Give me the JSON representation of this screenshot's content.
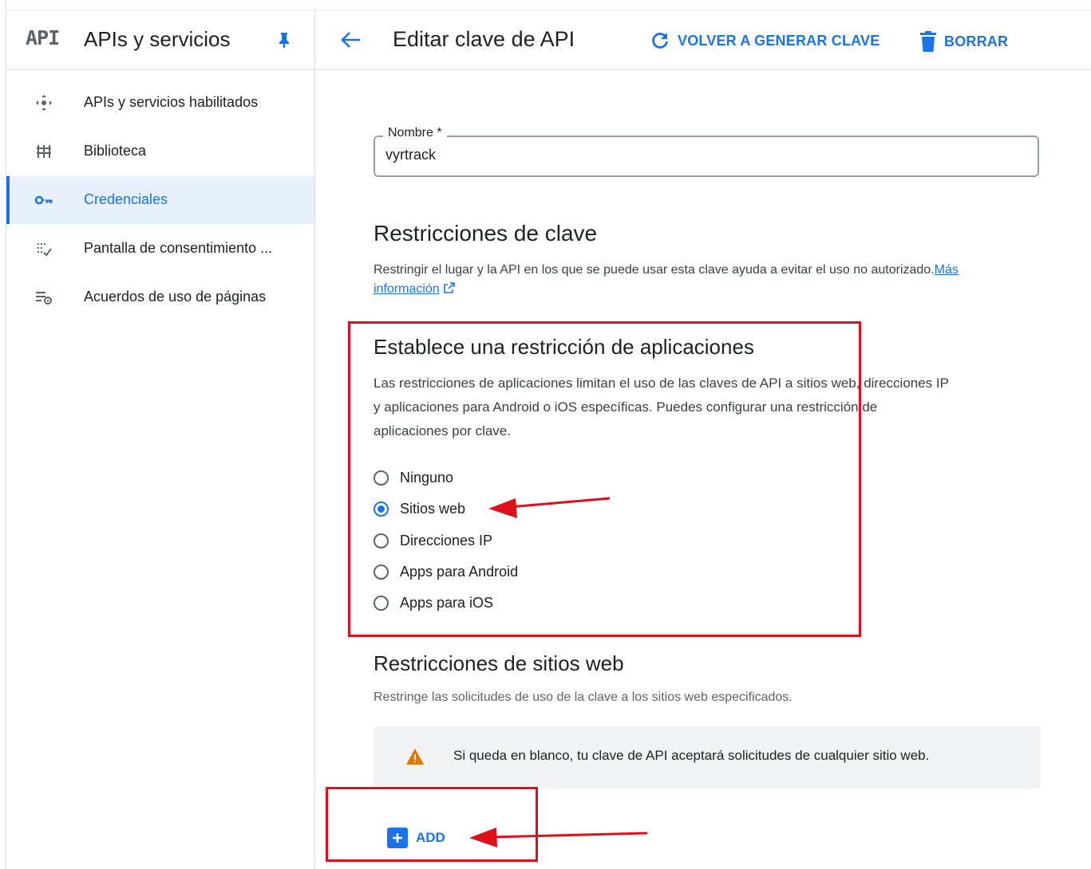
{
  "sidebar": {
    "logo_text": "API",
    "title": "APIs y servicios",
    "items": [
      {
        "label": "APIs y servicios habilitados",
        "icon": "apis-dashboard-icon",
        "active": false
      },
      {
        "label": "Biblioteca",
        "icon": "library-icon",
        "active": false
      },
      {
        "label": "Credenciales",
        "icon": "key-icon",
        "active": true
      },
      {
        "label": "Pantalla de consentimiento ...",
        "icon": "consent-screen-icon",
        "active": false
      },
      {
        "label": "Acuerdos de uso de páginas",
        "icon": "page-agreements-icon",
        "active": false
      }
    ]
  },
  "header": {
    "title": "Editar clave de API",
    "regenerate_label": "VOLVER A GENERAR CLAVE",
    "delete_label": "BORRAR"
  },
  "name_field": {
    "label": "Nombre *",
    "value": "vyrtrack"
  },
  "key_restrictions": {
    "title": "Restricciones de clave",
    "description": "Restringir el lugar y la API en los que se puede usar esta clave ayuda a evitar el uso no autorizado.",
    "link_part1": "Más",
    "link_part2": "información"
  },
  "app_restriction": {
    "title": "Establece una restricción de aplicaciones",
    "description_lines": [
      "Las restricciones de aplicaciones limitan el uso de las claves de API a sitios web, direcciones IP",
      "y aplicaciones para Android o iOS específicas. Puedes configurar una restricción de",
      "aplicaciones por clave."
    ],
    "options": [
      {
        "label": "Ninguno",
        "selected": false
      },
      {
        "label": "Sitios web",
        "selected": true
      },
      {
        "label": "Direcciones IP",
        "selected": false
      },
      {
        "label": "Apps para Android",
        "selected": false
      },
      {
        "label": "Apps para iOS",
        "selected": false
      }
    ]
  },
  "website_restrictions": {
    "title": "Restricciones de sitios web",
    "description": "Restringe las solicitudes de uso de la clave a los sitios web especificados.",
    "warning": "Si queda en blanco, tu clave de API aceptará solicitudes de cualquier sitio web.",
    "add_label": "ADD"
  },
  "colors": {
    "accent": "#1a73e8",
    "annotation_red": "#e0101a",
    "warning_orange": "#e37400",
    "active_nav_bg": "#e8f0fe"
  }
}
